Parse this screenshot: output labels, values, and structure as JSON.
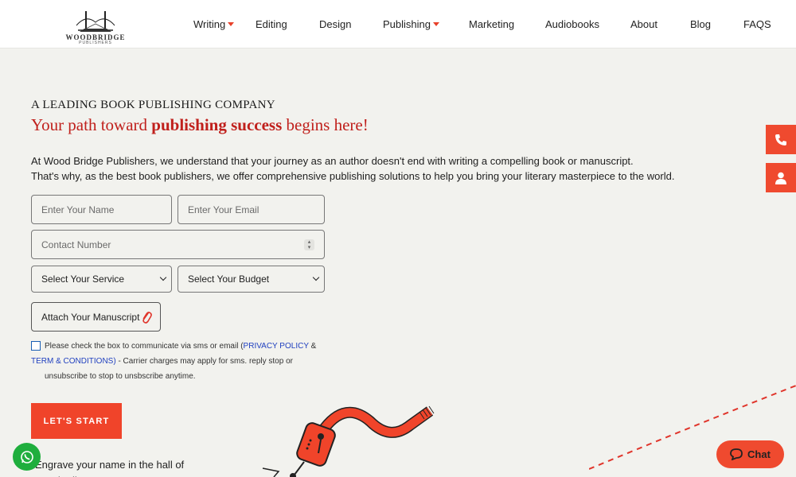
{
  "header": {
    "logo_text": "WOODBRIDGE",
    "logo_sub": "PUBLISHERS",
    "nav": [
      {
        "label": "Writing",
        "dropdown": true
      },
      {
        "label": "Editing",
        "dropdown": false
      },
      {
        "label": "Design",
        "dropdown": false
      },
      {
        "label": "Publishing",
        "dropdown": true
      },
      {
        "label": "Marketing",
        "dropdown": false
      },
      {
        "label": "Audiobooks",
        "dropdown": false
      },
      {
        "label": "About",
        "dropdown": false
      },
      {
        "label": "Blog",
        "dropdown": false
      },
      {
        "label": "FAQS",
        "dropdown": false
      }
    ]
  },
  "hero": {
    "eyebrow": "A LEADING BOOK PUBLISHING COMPANY",
    "headline_pre": "Your path toward ",
    "headline_bold": "publishing success",
    "headline_post": " begins here!",
    "intro_line1": "At Wood Bridge Publishers, we understand that your journey as an author doesn't end with writing a compelling book or manuscript.",
    "intro_line2": "That's why, as the best book publishers, we offer comprehensive publishing solutions to help you bring your literary masterpiece to the world."
  },
  "form": {
    "name_placeholder": "Enter Your Name",
    "email_placeholder": "Enter Your Email",
    "phone_placeholder": "Contact Number",
    "service_selected": "Select Your Service",
    "budget_selected": "Select Your Budget",
    "attach_label": "Attach Your Manuscript",
    "consent_pre": "Please check the box to communicate via sms or email (",
    "privacy_link": "PRIVACY POLICY",
    "consent_amp": " & ",
    "terms_link": "TERM & CONDITIONS)",
    "consent_post": " - Carrier charges may apply for sms. reply stop or unsubscribe to stop to unsbscribe anytime.",
    "cta_label": "LET'S START"
  },
  "engrave_text": "Engrave your name in the hall of popular literature",
  "chat_label": "Chat",
  "icons": {
    "phone": "phone-icon",
    "user": "user-icon",
    "whatsapp": "whatsapp-icon",
    "chat": "chat-bubble-icon",
    "attach": "paperclip-icon"
  },
  "colors": {
    "accent": "#ef4a2f",
    "headline": "#c0201c",
    "link": "#1f3fbf",
    "whatsapp": "#1fae3d",
    "background": "#f2f2ee"
  }
}
